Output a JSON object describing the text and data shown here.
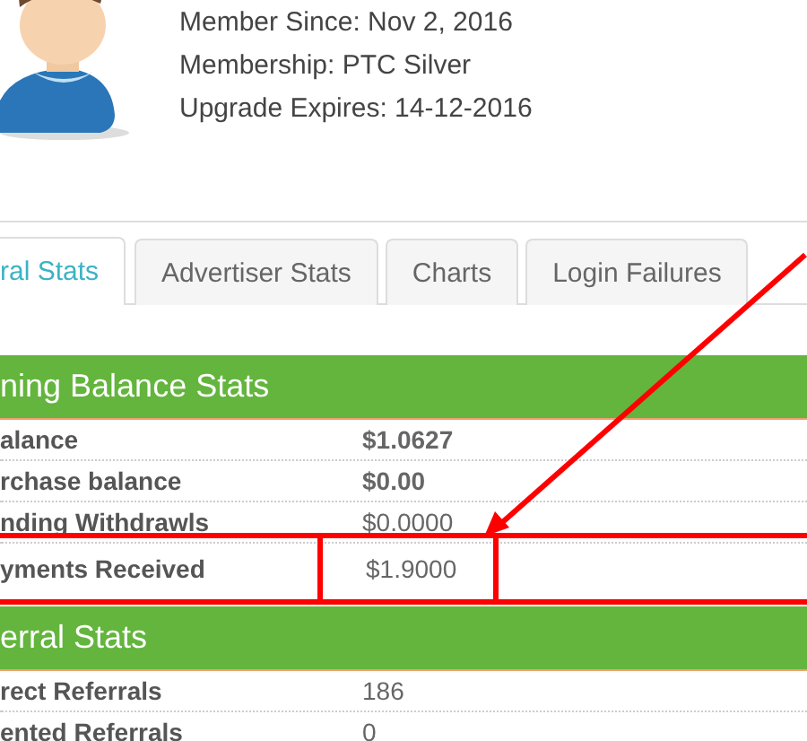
{
  "profile": {
    "lines": [
      "Member Since: Nov 2, 2016",
      "Membership: PTC Silver",
      "Upgrade Expires: 14-12-2016"
    ]
  },
  "tabs": [
    {
      "label": "ral Stats",
      "selected": true
    },
    {
      "label": "Advertiser Stats",
      "selected": false
    },
    {
      "label": "Charts",
      "selected": false
    },
    {
      "label": "Login Failures",
      "selected": false
    }
  ],
  "sections": [
    {
      "title": "ning Balance Stats",
      "rows": [
        {
          "label": "alance",
          "value": "$1.0627",
          "bold": true,
          "highlighted": false
        },
        {
          "label": "rchase balance",
          "value": "$0.00",
          "bold": true,
          "highlighted": false
        },
        {
          "label": "nding Withdrawls",
          "value": "$0.0000",
          "bold": false,
          "highlighted": false
        },
        {
          "label": "yments Received",
          "value": "$1.9000",
          "bold": false,
          "highlighted": true
        }
      ]
    },
    {
      "title": "erral Stats",
      "rows": [
        {
          "label": "rect Referrals",
          "value": "186",
          "bold": false,
          "highlighted": false
        },
        {
          "label": "ented Referrals",
          "value": "0",
          "bold": false,
          "highlighted": false
        }
      ]
    }
  ]
}
